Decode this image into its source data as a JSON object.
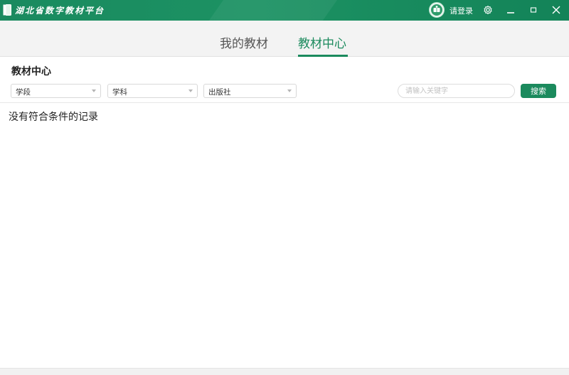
{
  "titlebar": {
    "app_title": "湖北省数字教材平台",
    "login_label": "请登录",
    "icons": [
      "book-logo-icon",
      "avatar-icon",
      "settings-gear-icon",
      "minimize-icon",
      "maximize-icon",
      "close-icon"
    ]
  },
  "tabs": [
    {
      "label": "我的教材",
      "active": false
    },
    {
      "label": "教材中心",
      "active": true
    }
  ],
  "panel": {
    "title": "教材中心",
    "filters": [
      {
        "label": "学段"
      },
      {
        "label": "学科"
      },
      {
        "label": "出版社"
      }
    ],
    "search": {
      "placeholder": "请输入关键字",
      "value": "",
      "button_label": "搜索"
    },
    "empty_message": "没有符合条件的记录"
  },
  "colors": {
    "brand_green": "#1b8a5d",
    "titlebar_green": "#1c9263",
    "tabbar_bg": "#f3f3f3"
  }
}
